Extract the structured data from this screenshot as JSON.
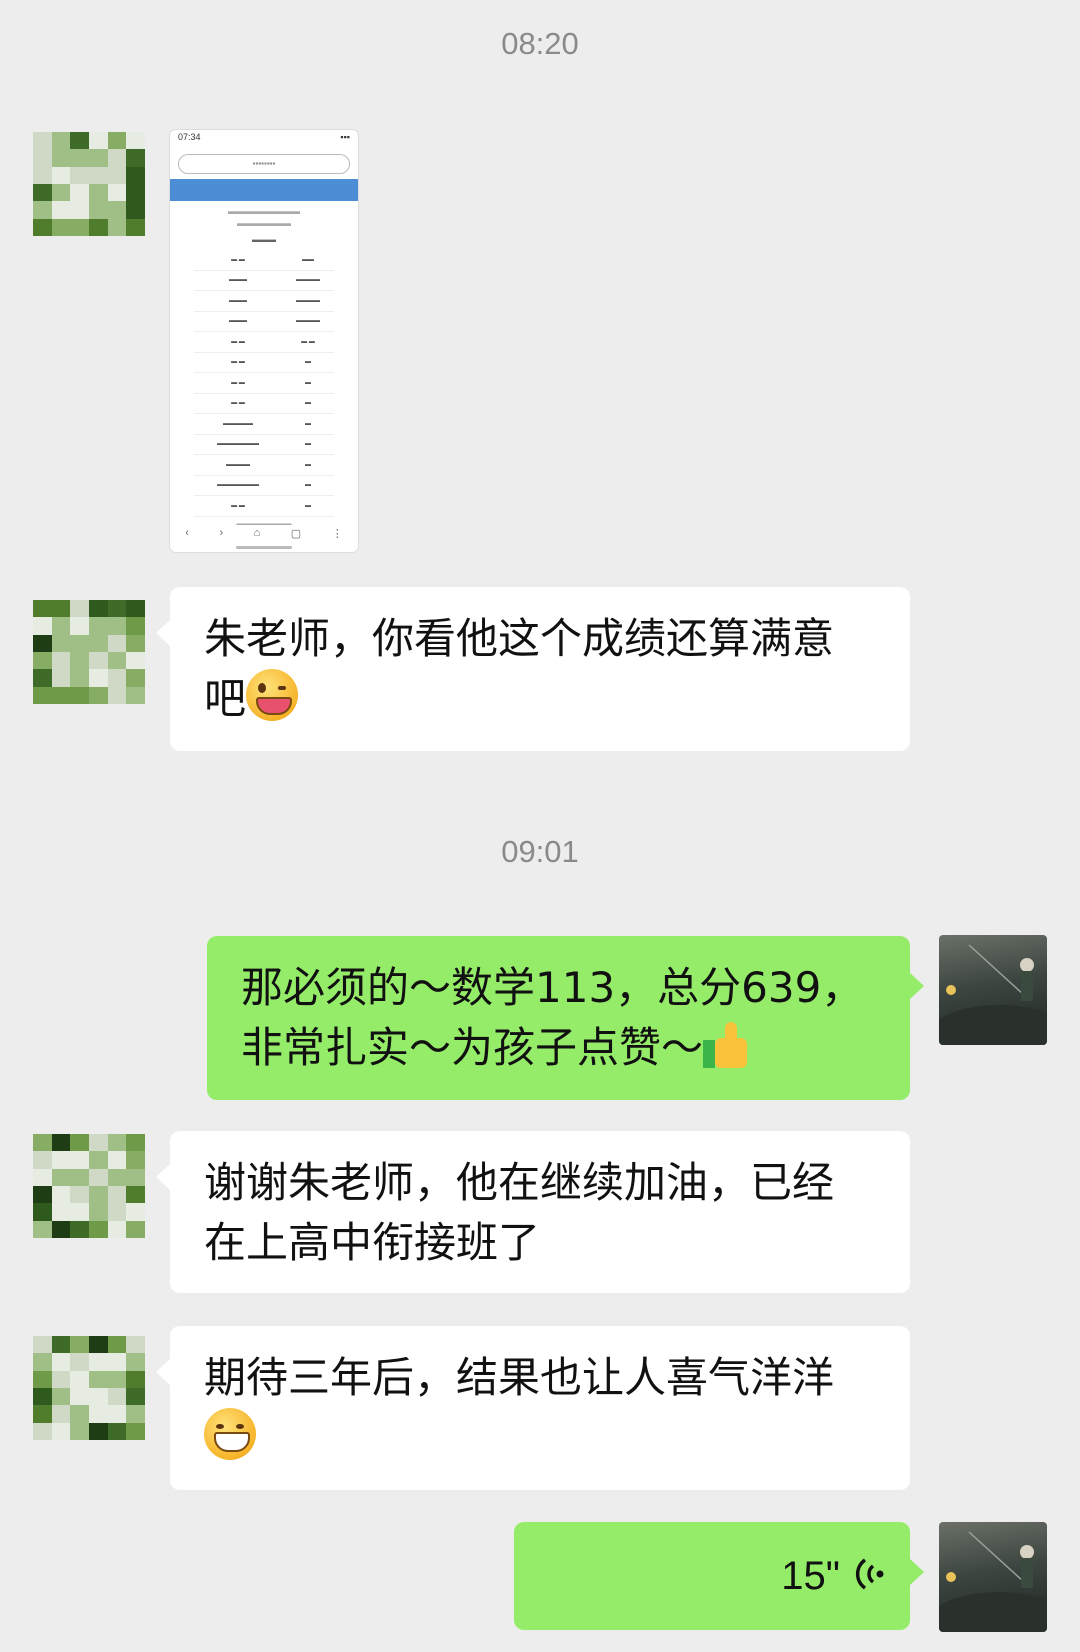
{
  "chat": {
    "timestamp_1": "08:20",
    "timestamp_2": "09:01",
    "messages": [
      {
        "sender": "other",
        "type": "image"
      },
      {
        "sender": "other",
        "type": "text",
        "text": "朱老师，你看他这个成绩还算满意吧",
        "emoji": "wink-tongue"
      },
      {
        "sender": "self",
        "type": "text",
        "text_line1": "那必须的～数学113，总分639，",
        "text_line2": "非常扎实～为孩子点赞～",
        "emoji": "thumbs-up"
      },
      {
        "sender": "other",
        "type": "text",
        "text_line1": "谢谢朱老师，他在继续加油，已经",
        "text_line2": "在上高中衔接班了"
      },
      {
        "sender": "other",
        "type": "text",
        "text": "期待三年后，结果也让人喜气洋洋",
        "emoji": "grin"
      },
      {
        "sender": "self",
        "type": "voice",
        "duration": "15\""
      }
    ]
  },
  "msg2": {
    "line1": "朱老师，你看他这个成绩还算满意",
    "line2": "吧"
  },
  "msg3": {
    "line1": "那必须的～数学113，总分639，",
    "line2": "非常扎实～为孩子点赞～"
  },
  "msg4": {
    "line1": "谢谢朱老师，他在继续加油，已经",
    "line2": "在上高中衔接班了"
  },
  "msg5": {
    "line1": "期待三年后，结果也让人喜气洋洋"
  },
  "voice": {
    "duration": "15\""
  },
  "colors": {
    "bg": "#ededed",
    "bubble_in": "#ffffff",
    "bubble_out": "#95ec69",
    "timestamp": "#8a8a8a"
  }
}
